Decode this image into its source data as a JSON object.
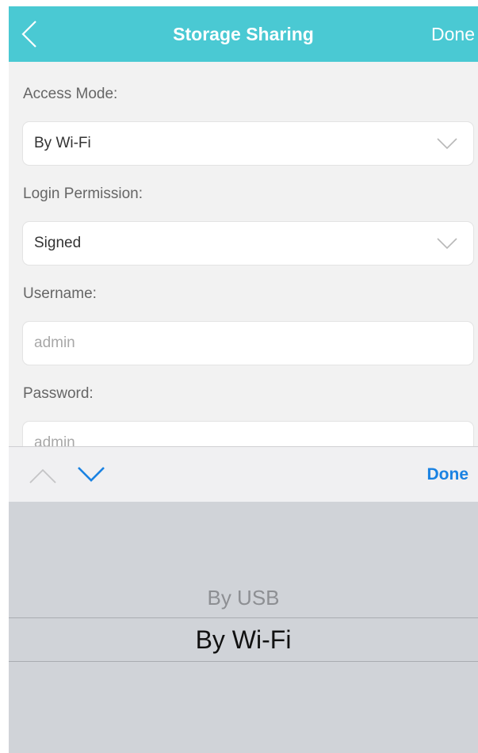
{
  "navbar": {
    "back_icon": "chevron-left-icon",
    "title": "Storage Sharing",
    "done_label": "Done",
    "background": "#4ac9d3"
  },
  "form": {
    "access_mode": {
      "label": "Access Mode:",
      "value": "By Wi-Fi",
      "icon": "chevron-down-icon"
    },
    "login_permission": {
      "label": "Login Permission:",
      "value": "Signed",
      "icon": "chevron-down-icon"
    },
    "username": {
      "label": "Username:",
      "placeholder": "admin"
    },
    "password": {
      "label": "Password:",
      "placeholder": "admin"
    }
  },
  "accessory": {
    "prev_icon": "chevron-up-icon",
    "next_icon": "chevron-down-icon",
    "done_label": "Done",
    "accent": "#1a82e2"
  },
  "picker": {
    "options": [
      "By USB",
      "By Wi-Fi"
    ],
    "selected": "By Wi-Fi"
  }
}
